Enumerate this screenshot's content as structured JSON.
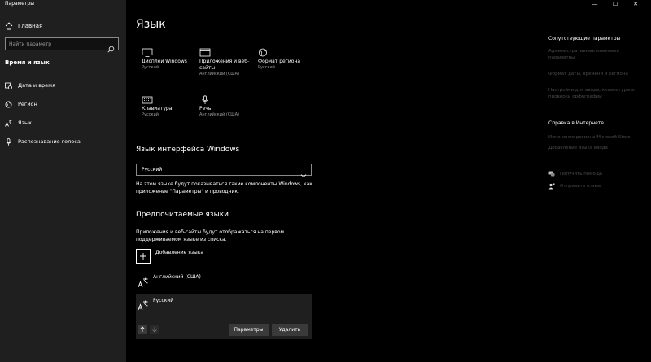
{
  "window": {
    "title": "Параметры",
    "minimize": "—",
    "maximize": "☐",
    "close": "✕"
  },
  "sidebar": {
    "home_label": "Главная",
    "search_placeholder": "Найти параметр",
    "section_label": "Время и язык",
    "items": [
      {
        "label": "Дата и время",
        "icon": "calendar-clock-icon"
      },
      {
        "label": "Регион",
        "icon": "globe-region-icon"
      },
      {
        "label": "Язык",
        "icon": "language-icon"
      },
      {
        "label": "Распознавание голоса",
        "icon": "microphone-icon"
      }
    ]
  },
  "main": {
    "title": "Язык",
    "tiles": [
      {
        "title": "Дисплей Windows",
        "subtitle": "Русский",
        "icon": "monitor-icon"
      },
      {
        "title": "Приложения и веб-сайты",
        "subtitle": "Английский (США)",
        "icon": "window-icon"
      },
      {
        "title": "Формат региона",
        "subtitle": "Русский",
        "icon": "region-format-icon"
      },
      {
        "title": "Клавиатура",
        "subtitle": "Русский",
        "icon": "keyboard-icon"
      },
      {
        "title": "Речь",
        "subtitle": "Английский (США)",
        "icon": "microphone-icon"
      }
    ],
    "display_language": {
      "heading": "Язык интерфейса Windows",
      "selected": "Русский",
      "description": "На этом языке будут показываться такие компоненты Windows, как приложение \"Параметры\" и проводник."
    },
    "preferred": {
      "heading": "Предпочитаемые языки",
      "description": "Приложения и веб-сайты будут отображаться на первом поддерживаемом языке из списка.",
      "add_label": "Добавление языка",
      "languages": [
        "Английский (США)",
        "Русский"
      ],
      "options_button": "Параметры",
      "remove_button": "Удалить"
    }
  },
  "right_panel": {
    "related_heading": "Сопутствующие параметры",
    "related_links": [
      "Административные языковые параметры",
      "Формат даты, времени и региона",
      "Настройки для ввода, клавиатуры и проверки орфографии"
    ],
    "web_help_heading": "Справка в Интернете",
    "web_help_links": [
      "Изменение региона Microsoft Store",
      "Добавление языка ввода"
    ],
    "get_help": "Получить помощь",
    "send_feedback": "Отправить отзыв"
  },
  "colors": {
    "background": "#000000",
    "sidebar": "#1f1f1f",
    "disabled_link": "#4a4a4a",
    "button": "#3a3a3a"
  }
}
